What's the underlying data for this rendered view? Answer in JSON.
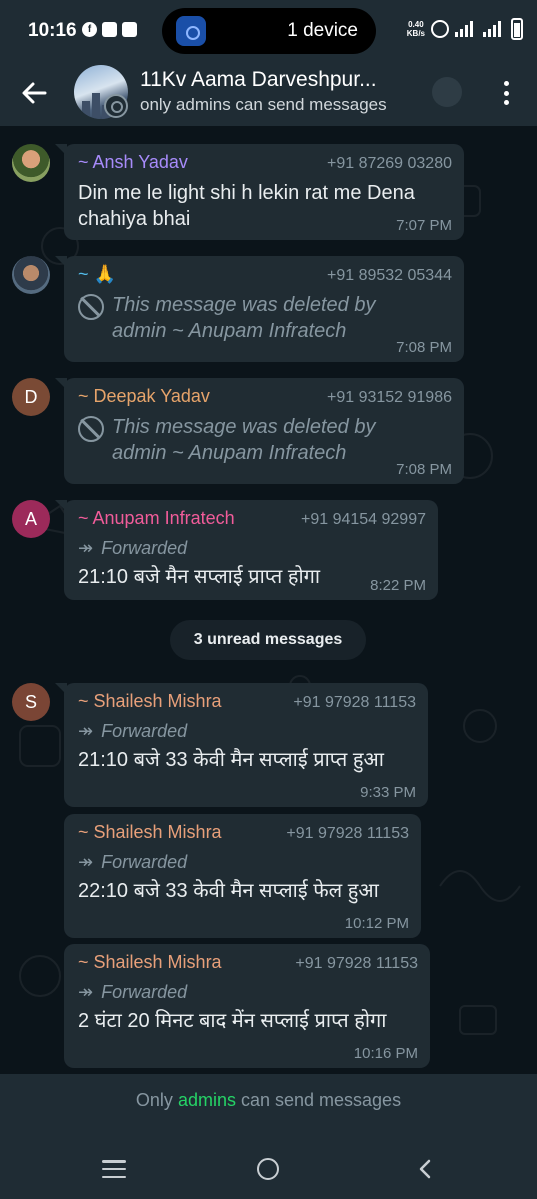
{
  "status_bar": {
    "time": "10:16",
    "island_text": "1 device",
    "island_badge": "1",
    "data_rate_value": "0.40",
    "data_rate_unit": "KB/s",
    "network": "5G",
    "network2": "G"
  },
  "header": {
    "title": "11Kv Aama Darveshpur...",
    "subtitle": "only admins can send messages"
  },
  "messages": [
    {
      "sender": "~ Ansh Yadav",
      "phone": "+91 87269 03280",
      "text": "Din me le light shi h lekin rat me Dena chahiya bhai",
      "time": "7:07 PM",
      "sender_color": "#a78bfa"
    },
    {
      "sender": "~ 🙏",
      "phone": "+91 89532 05344",
      "text": "This message was deleted by admin ~ Anupam Infratech",
      "time": "7:08 PM",
      "sender_color": "#53bdeb"
    },
    {
      "sender": "~ Deepak Yadav",
      "phone": "+91 93152 91986",
      "avatar_letter": "D",
      "text": "This message was deleted by admin ~ Anupam Infratech",
      "time": "7:08 PM",
      "sender_color": "#e6a46b"
    },
    {
      "sender": "~ Anupam Infratech",
      "phone": "+91 94154 92997",
      "avatar_letter": "A",
      "forwarded": "Forwarded",
      "text": "21:10 बजे मैन सप्लाई प्राप्त होगा",
      "time": "8:22 PM",
      "sender_color": "#f15c9a"
    },
    {
      "sender": "~ Shailesh Mishra",
      "phone": "+91 97928 11153",
      "avatar_letter": "S",
      "forwarded": "Forwarded",
      "text": "21:10 बजे 33 केवी मैन सप्लाई प्राप्त हुआ",
      "time": "9:33 PM",
      "sender_color": "#e8a07a"
    },
    {
      "sender": "~ Shailesh Mishra",
      "phone": "+91 97928 11153",
      "forwarded": "Forwarded",
      "text": "22:10 बजे 33 केवी मैन सप्लाई फेल हुआ",
      "time": "10:12 PM",
      "sender_color": "#e8a07a"
    },
    {
      "sender": "~ Shailesh Mishra",
      "phone": "+91 97928 11153",
      "forwarded": "Forwarded",
      "text": "2 घंटा 20 मिनट बाद मेंन सप्लाई प्राप्त होगा",
      "time": "10:16 PM",
      "sender_color": "#e8a07a"
    }
  ],
  "unread_label": "3 unread messages",
  "footer": {
    "before": "Only ",
    "link": "admins",
    "after": " can send messages"
  },
  "colors": {
    "deepak_avatar": "#7a4a35",
    "anupam_avatar": "#9c2a5a",
    "shailesh_avatar": "#7a4535"
  },
  "icons": [
    "back-arrow-icon",
    "community-icon",
    "voice-call-icon",
    "more-options-icon",
    "deleted-icon",
    "forward-icon"
  ]
}
